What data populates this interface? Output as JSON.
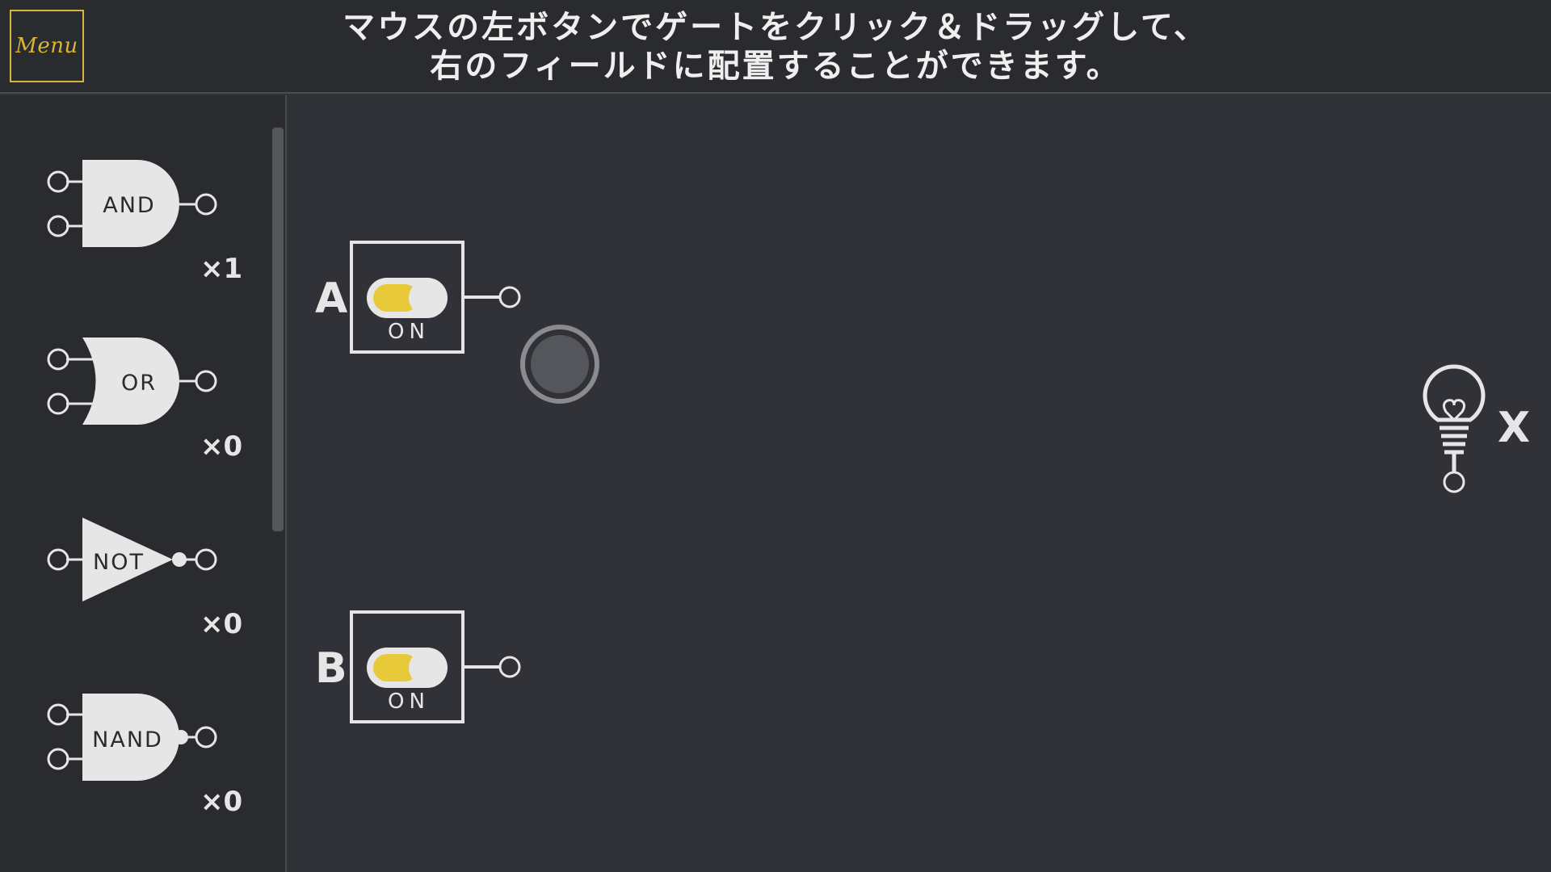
{
  "header": {
    "menu_label": "Menu",
    "instruction_line1": "マウスの左ボタンでゲートをクリック＆ドラッグして、",
    "instruction_line2": "右のフィールドに配置することができます。"
  },
  "palette": {
    "gates": [
      {
        "name": "AND",
        "count": "×1"
      },
      {
        "name": "OR",
        "count": "×0"
      },
      {
        "name": "NOT",
        "count": "×0"
      },
      {
        "name": "NAND",
        "count": "×0"
      }
    ]
  },
  "field": {
    "inputs": [
      {
        "label": "A",
        "state": "ON"
      },
      {
        "label": "B",
        "state": "ON"
      }
    ],
    "output": {
      "label": "X",
      "icon": "lightbulb-icon"
    }
  },
  "colors": {
    "accent": "#d9b436",
    "switch_on": "#e8c93a"
  }
}
